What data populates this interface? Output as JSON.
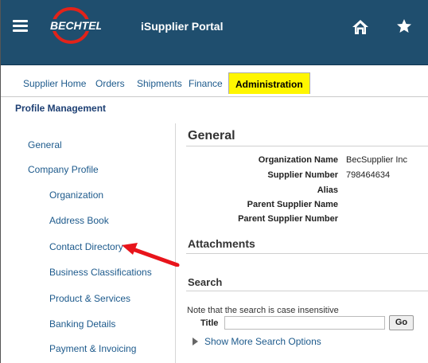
{
  "header": {
    "portal_title": "iSupplier Portal",
    "logo_text": "BECHTEL",
    "background_color": "#1f4e6e",
    "icons": [
      "menu-icon",
      "home-icon",
      "star-icon"
    ]
  },
  "tabs": [
    {
      "label": "Supplier Home",
      "active": false
    },
    {
      "label": "Orders",
      "active": false
    },
    {
      "label": "Shipments",
      "active": false
    },
    {
      "label": "Finance",
      "active": false
    },
    {
      "label": "Administration",
      "active": true
    }
  ],
  "active_tab_color": "#fff600",
  "subheader": {
    "label": "Profile Management"
  },
  "sidebar": {
    "items": [
      {
        "label": "General"
      },
      {
        "label": "Company Profile"
      },
      {
        "label": "Organization"
      },
      {
        "label": "Address Book"
      },
      {
        "label": "Contact Directory"
      },
      {
        "label": "Business Classifications"
      },
      {
        "label": "Product & Services"
      },
      {
        "label": "Banking Details"
      },
      {
        "label": "Payment & Invoicing"
      }
    ]
  },
  "general": {
    "title": "General",
    "fields": [
      {
        "label": "Organization Name",
        "value": "BecSupplier Inc"
      },
      {
        "label": "Supplier Number",
        "value": "798464634"
      },
      {
        "label": "Alias",
        "value": ""
      },
      {
        "label": "Parent Supplier Name",
        "value": ""
      },
      {
        "label": "Parent Supplier Number",
        "value": ""
      }
    ]
  },
  "attachments": {
    "title": "Attachments"
  },
  "search": {
    "title": "Search",
    "note": "Note that the search is case insensitive",
    "title_label": "Title",
    "title_value": "",
    "go_label": "Go",
    "more_options": "Show More Search Options"
  },
  "annotation": {
    "arrow_color": "#e8141b",
    "points_to": "Contact Directory"
  }
}
